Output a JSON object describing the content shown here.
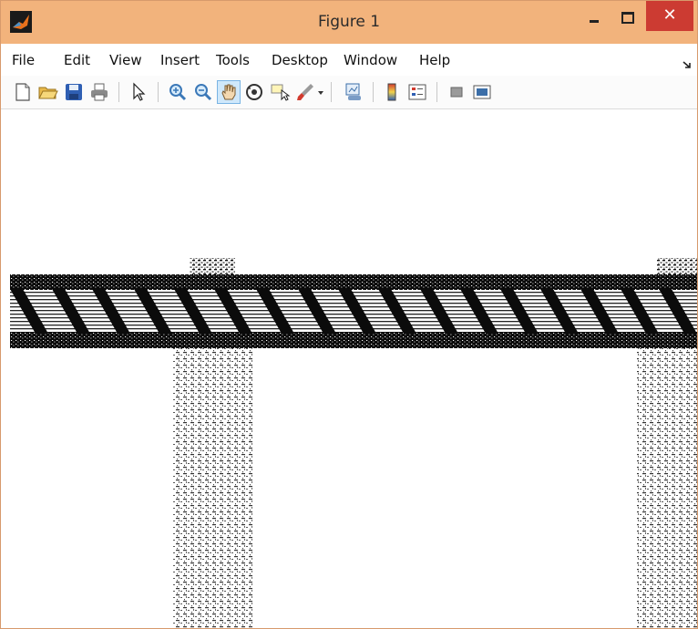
{
  "window": {
    "title": "Figure 1",
    "close_label": "✕",
    "title_bar_color": "#f2b37c",
    "close_button_color": "#cc3b32"
  },
  "menu": {
    "items": [
      "File",
      "Edit",
      "View",
      "Insert",
      "Tools",
      "Desktop",
      "Window",
      "Help"
    ]
  },
  "toolbar": {
    "icons": [
      "new-figure-icon",
      "open-file-icon",
      "save-icon",
      "print-icon",
      "edit-plot-icon",
      "zoom-in-icon",
      "zoom-out-icon",
      "pan-icon",
      "rotate-3d-icon",
      "data-cursor-icon",
      "brush-icon",
      "brush-dropdown-icon",
      "link-plot-icon",
      "insert-colorbar-icon",
      "insert-legend-icon",
      "hide-plot-tools-icon",
      "show-plot-tools-icon"
    ],
    "active_tool": "pan-icon"
  },
  "figure": {
    "content": "binary truss bridge image",
    "foreground_color": "#000000",
    "background_color": "#ffffff"
  }
}
